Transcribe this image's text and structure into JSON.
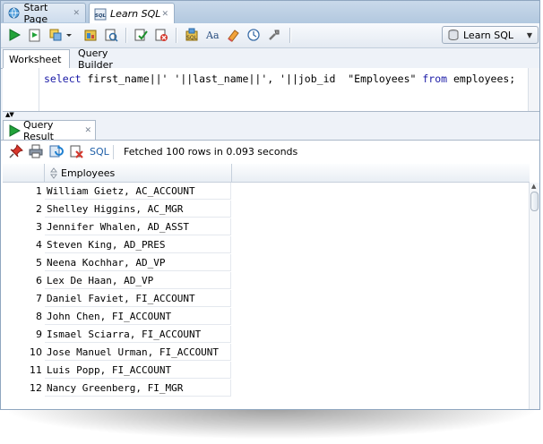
{
  "tabs": [
    {
      "label": "Start Page",
      "icon": "globe-icon"
    },
    {
      "label": "Learn SQL",
      "icon": "sql-file-icon",
      "active": true
    }
  ],
  "toolbar": {
    "connection": "Learn SQL",
    "icons": [
      "run-statement-icon",
      "run-script-icon",
      "explain-plan-icon",
      "dropdown-arrow-icon",
      "autotrace-icon",
      "sql-tuning-icon",
      "commit-icon",
      "rollback-icon",
      "unshared-worksheet-icon",
      "to-uppercase-icon",
      "clear-icon",
      "sql-history-icon",
      "sql-tuning-advisor-icon"
    ]
  },
  "worksheet_tabs": [
    "Worksheet",
    "Query Builder"
  ],
  "editor": {
    "select_kw": "select",
    "part1": " first_name||' '||last_name||', '||job_id  \"Employees\" ",
    "from_kw": "from",
    "part2": " employees;"
  },
  "result": {
    "tab_label": "Query Result",
    "sql_link": "SQL",
    "status": "Fetched 100 rows in 0.093 seconds",
    "column": "Employees",
    "rows": [
      {
        "n": "1",
        "v": "William Gietz, AC_ACCOUNT"
      },
      {
        "n": "2",
        "v": "Shelley Higgins, AC_MGR"
      },
      {
        "n": "3",
        "v": "Jennifer Whalen, AD_ASST"
      },
      {
        "n": "4",
        "v": "Steven King, AD_PRES"
      },
      {
        "n": "5",
        "v": "Neena Kochhar, AD_VP"
      },
      {
        "n": "6",
        "v": "Lex De Haan, AD_VP"
      },
      {
        "n": "7",
        "v": "Daniel Faviet, FI_ACCOUNT"
      },
      {
        "n": "8",
        "v": "John Chen, FI_ACCOUNT"
      },
      {
        "n": "9",
        "v": "Ismael Sciarra, FI_ACCOUNT"
      },
      {
        "n": "10",
        "v": "Jose Manuel Urman, FI_ACCOUNT"
      },
      {
        "n": "11",
        "v": "Luis Popp, FI_ACCOUNT"
      },
      {
        "n": "12",
        "v": "Nancy Greenberg, FI_MGR"
      }
    ]
  },
  "colors": {
    "keyword": "#1a1aa6",
    "link": "#1f5fa8",
    "run_green": "#1e9e2e",
    "frame": "#8fa6bf"
  }
}
